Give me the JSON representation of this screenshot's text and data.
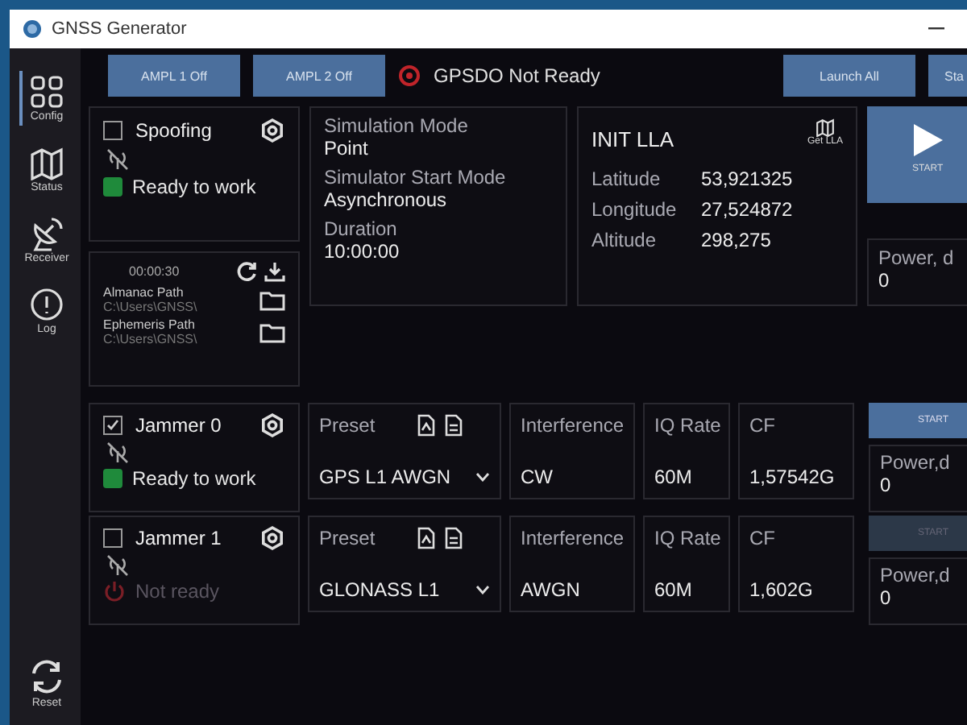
{
  "window": {
    "title": "GNSS Generator"
  },
  "sidebar": {
    "items": [
      {
        "label": "Config",
        "selected": true
      },
      {
        "label": "Status",
        "selected": false
      },
      {
        "label": "Receiver",
        "selected": false
      },
      {
        "label": "Log",
        "selected": false
      }
    ],
    "reset": "Reset"
  },
  "toolbar": {
    "buttons": [
      "AMPL 1 Off",
      "AMPL 2 Off"
    ],
    "gpsdo": {
      "text": "GPSDO Not Ready",
      "ready": false
    },
    "right_buttons": [
      "Launch All",
      "Sta"
    ]
  },
  "spoofing": {
    "title": "Spoofing",
    "checked": false,
    "ready": true,
    "status": "Ready to work"
  },
  "files": {
    "time": "00:00:30",
    "almanac_label": "Almanac Path",
    "almanac_path": "C:\\Users\\GNSS\\",
    "ephemeris_label": "Ephemeris Path",
    "ephemeris_path": "C:\\Users\\GNSS\\"
  },
  "simulation": [
    {
      "label": "Simulation Mode",
      "value": "Point"
    },
    {
      "label": "Simulator Start Mode",
      "value": "Asynchronous"
    },
    {
      "label": "Duration",
      "value": "10:00:00"
    }
  ],
  "init_lla": {
    "title": "INIT LLA",
    "map_button": "Get LLA",
    "rows": [
      {
        "label": "Latitude",
        "value": "53,921325"
      },
      {
        "label": "Longitude",
        "value": "27,524872"
      },
      {
        "label": "Altitude",
        "value": "298,275"
      }
    ]
  },
  "spoof_control": {
    "start": "START",
    "power_label": "Power, d",
    "power_value": "0"
  },
  "jammers": [
    {
      "title": "Jammer 0",
      "checked": true,
      "ready": true,
      "status": "Ready to work",
      "preset_label": "Preset",
      "preset": "GPS L1 AWGN",
      "interference_label": "Interference",
      "interference": "CW",
      "iq_label": "IQ Rate",
      "iq": "60M",
      "cf_label": "CF",
      "cf": "1,57542G",
      "start": "START",
      "start_enabled": true,
      "power_label": "Power,d",
      "power_value": "0"
    },
    {
      "title": "Jammer 1",
      "checked": false,
      "ready": false,
      "status": "Not ready",
      "preset_label": "Preset",
      "preset": "GLONASS L1",
      "interference_label": "Interference",
      "interference": "AWGN",
      "iq_label": "IQ Rate",
      "iq": "60M",
      "cf_label": "CF",
      "cf": "1,602G",
      "start": "START",
      "start_enabled": false,
      "power_label": "Power,d",
      "power_value": "0"
    }
  ]
}
